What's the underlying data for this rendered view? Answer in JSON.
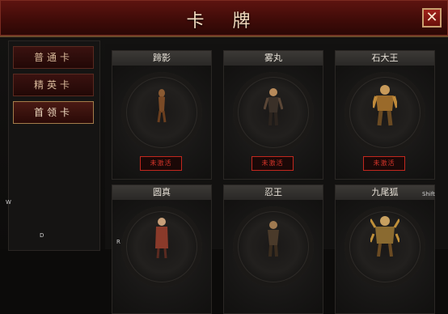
{
  "window": {
    "title": "卡 牌"
  },
  "sidebar": {
    "items": [
      {
        "label": "普通卡",
        "active": false
      },
      {
        "label": "精英卡",
        "active": false
      },
      {
        "label": "首领卡",
        "active": true
      }
    ]
  },
  "cards": [
    {
      "name": "蹄影",
      "status": "未激活"
    },
    {
      "name": "雾丸",
      "status": "未激活"
    },
    {
      "name": "石大王",
      "status": "未激活"
    },
    {
      "name": "圆真"
    },
    {
      "name": "忍王"
    },
    {
      "name": "九尾狐"
    }
  ],
  "keys": {
    "w": "W",
    "d": "D",
    "r": "R",
    "shift": "Shift"
  },
  "colors": {
    "accent": "#c2271e",
    "title_bar": "#4a0f0b",
    "frame": "#a37c4a"
  }
}
